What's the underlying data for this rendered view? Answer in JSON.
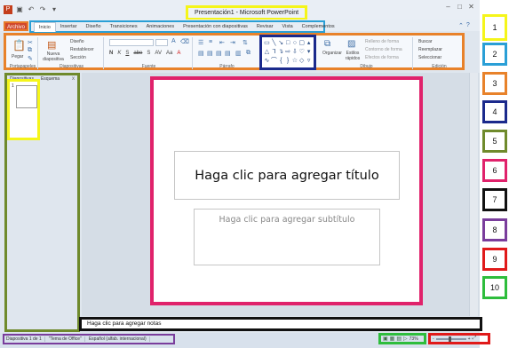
{
  "window": {
    "title": "Presentación1 - Microsoft PowerPoint",
    "qat_icons": [
      "powerpoint-logo-icon",
      "save-icon",
      "undo-icon",
      "redo-icon",
      "customize-icon"
    ]
  },
  "tabs": {
    "file": "Archivo",
    "items": [
      "Inicio",
      "Insertar",
      "Diseño",
      "Transiciones",
      "Animaciones",
      "Presentación con diapositivas",
      "Revisar",
      "Vista",
      "Complementos"
    ],
    "active": "Inicio"
  },
  "ribbon": {
    "groups": {
      "portapapeles": "Portapapeles",
      "diapositivas": "Diapositivas",
      "fuente": "Fuente",
      "parrafo": "Párrafo",
      "dibujo": "Dibujo",
      "edicion": "Edición"
    },
    "pegar": "Pegar",
    "nueva_diapositiva": "Nueva diapositiva",
    "diseno": "Diseño",
    "restablecer": "Restablecer",
    "seccion": "Sección",
    "organizar": "Organizar",
    "estilos_rapidos": "Estilos rápidos",
    "relleno_forma": "Relleno de forma",
    "contorno_forma": "Contorno de forma",
    "efectos_forma": "Efectos de forma",
    "buscar": "Buscar",
    "reemplazar": "Reemplazar",
    "seleccionar": "Seleccionar",
    "font_format": [
      "N",
      "K",
      "S",
      "abe",
      "S",
      "AV",
      "Aa",
      "A"
    ]
  },
  "pane": {
    "tab_slides": "Diapositivas",
    "tab_outline": "Esquema",
    "close": "x",
    "slide_number": "1"
  },
  "slide": {
    "title_placeholder": "Haga clic para agregar título",
    "subtitle_placeholder": "Haga clic para agregar subtítulo"
  },
  "notes": {
    "placeholder": "Haga clic para agregar notas"
  },
  "status": {
    "slide_of": "Diapositiva 1 de 1",
    "theme": "\"Tema de Office\"",
    "language": "Español (alfab. internacional)"
  },
  "zoom": {
    "percent": "73%",
    "minus": "-",
    "plus": "+",
    "slider_fraction": 0.45
  },
  "legend": [
    "1",
    "2",
    "3",
    "4",
    "5",
    "6",
    "7",
    "8",
    "9",
    "10"
  ],
  "legend_colors": [
    "#f5f51a",
    "#2a9fd6",
    "#e8822a",
    "#1b2a8c",
    "#6f8a2c",
    "#e0226b",
    "#111111",
    "#7a3d9c",
    "#e01a1a",
    "#2ebd3c"
  ]
}
